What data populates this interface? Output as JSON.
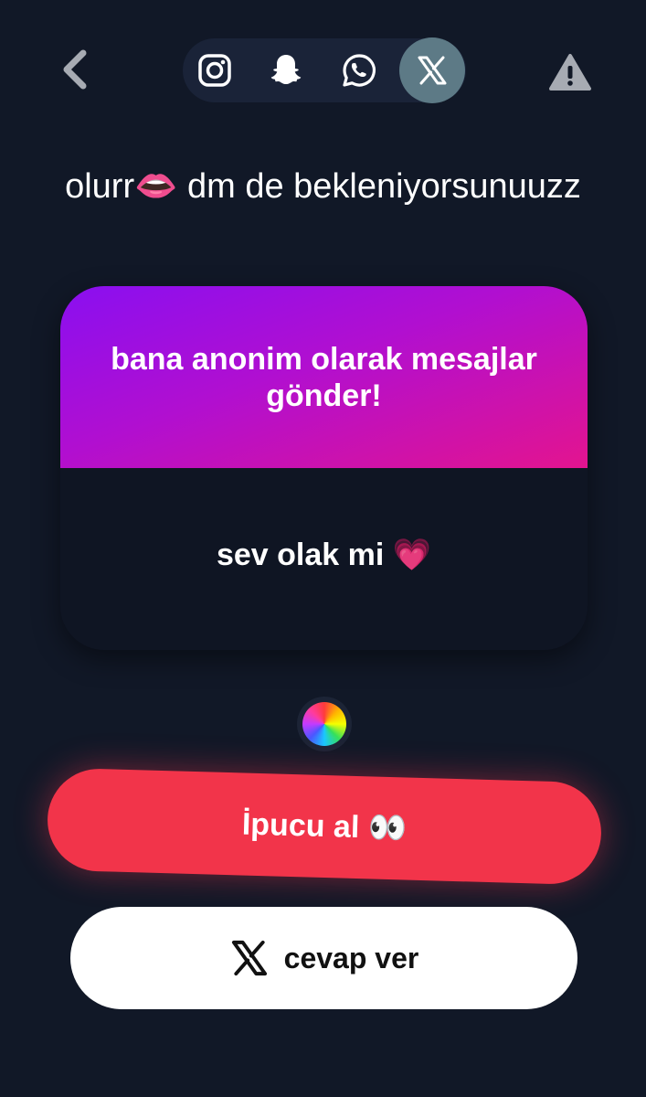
{
  "topbar": {
    "back_icon": "chevron-left-icon",
    "share_icons": [
      "instagram-icon",
      "snapchat-icon",
      "whatsapp-icon",
      "x-icon"
    ],
    "report_icon": "warning-icon"
  },
  "profile": {
    "text": "olurr👄 dm de bekleniyorsunuuzz"
  },
  "card": {
    "header": "bana anonim olarak mesajlar gönder!",
    "message": "sev olak mi 💗"
  },
  "hint_button": {
    "label": "İpucu al 👀"
  },
  "reply_button": {
    "label": "cevap ver",
    "icon": "x-icon"
  },
  "colors": {
    "background": "#111827",
    "accent_red": "#f2344a",
    "gradient_start": "#8a0ff0",
    "gradient_end": "#e3148f"
  }
}
